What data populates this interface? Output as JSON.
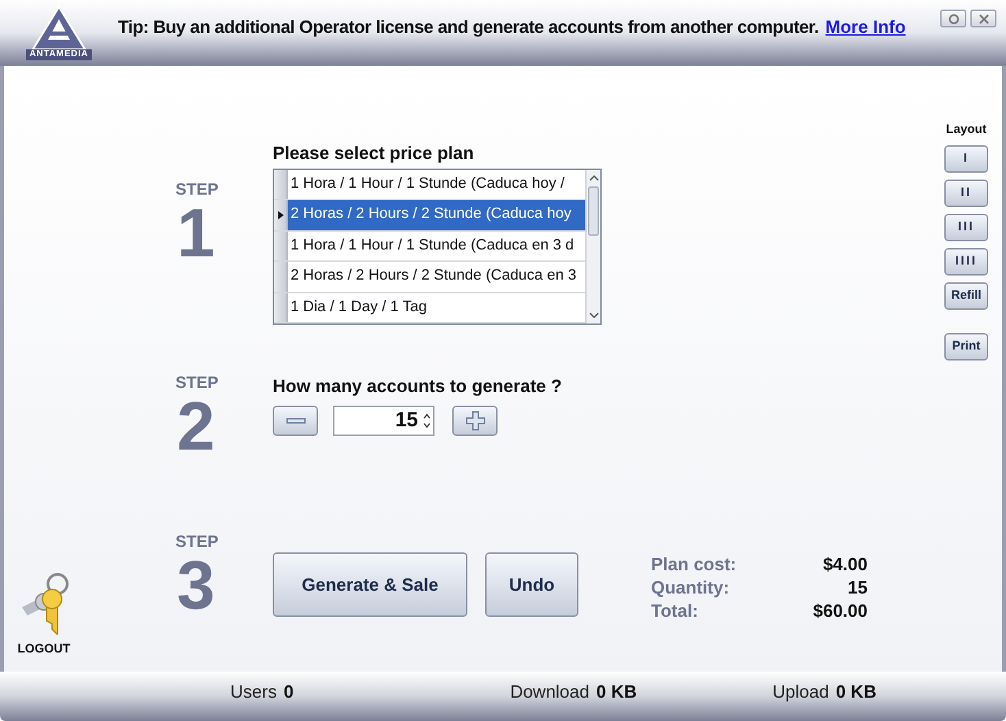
{
  "header": {
    "logo_text": "ANTAMEDIA",
    "tip": "Tip: Buy an additional Operator license and generate accounts from another computer.",
    "tip_link": "More Info"
  },
  "price_plan": {
    "step_label": "STEP",
    "step": "1",
    "title": "Please select price plan",
    "plans": [
      {
        "label": "1 Hora / 1 Hour / 1 Stunde (Caduca hoy /",
        "selected": false
      },
      {
        "label": "2 Horas / 2 Hours / 2 Stunde (Caduca hoy",
        "selected": true
      },
      {
        "label": "1 Hora / 1 Hour / 1 Stunde (Caduca en 3 d",
        "selected": false
      },
      {
        "label": "2 Horas / 2 Hours / 2 Stunde (Caduca en 3",
        "selected": false
      },
      {
        "label": "1 Dia / 1 Day / 1 Tag",
        "selected": false
      }
    ]
  },
  "accounts": {
    "step_label": "STEP",
    "step": "2",
    "title": "How many accounts to generate ?",
    "quantity": "15"
  },
  "actions": {
    "step_label": "STEP",
    "step": "3",
    "buttons": [
      "Generate & Sale",
      "Undo"
    ]
  },
  "summary": [
    {
      "label": "Plan cost:",
      "value": "$4.00"
    },
    {
      "label": "Quantity:",
      "value": "15"
    },
    {
      "label": "Total:",
      "value": "$60.00"
    }
  ],
  "layout": {
    "title": "Layout",
    "buttons": [
      "I",
      "II",
      "III",
      "IIII",
      "Refill"
    ],
    "print": "Print"
  },
  "logout": "LOGOUT",
  "status": [
    {
      "label": "Users",
      "value": "0"
    },
    {
      "label": "Download",
      "value": "0 KB"
    },
    {
      "label": "Upload",
      "value": "0 KB"
    }
  ]
}
